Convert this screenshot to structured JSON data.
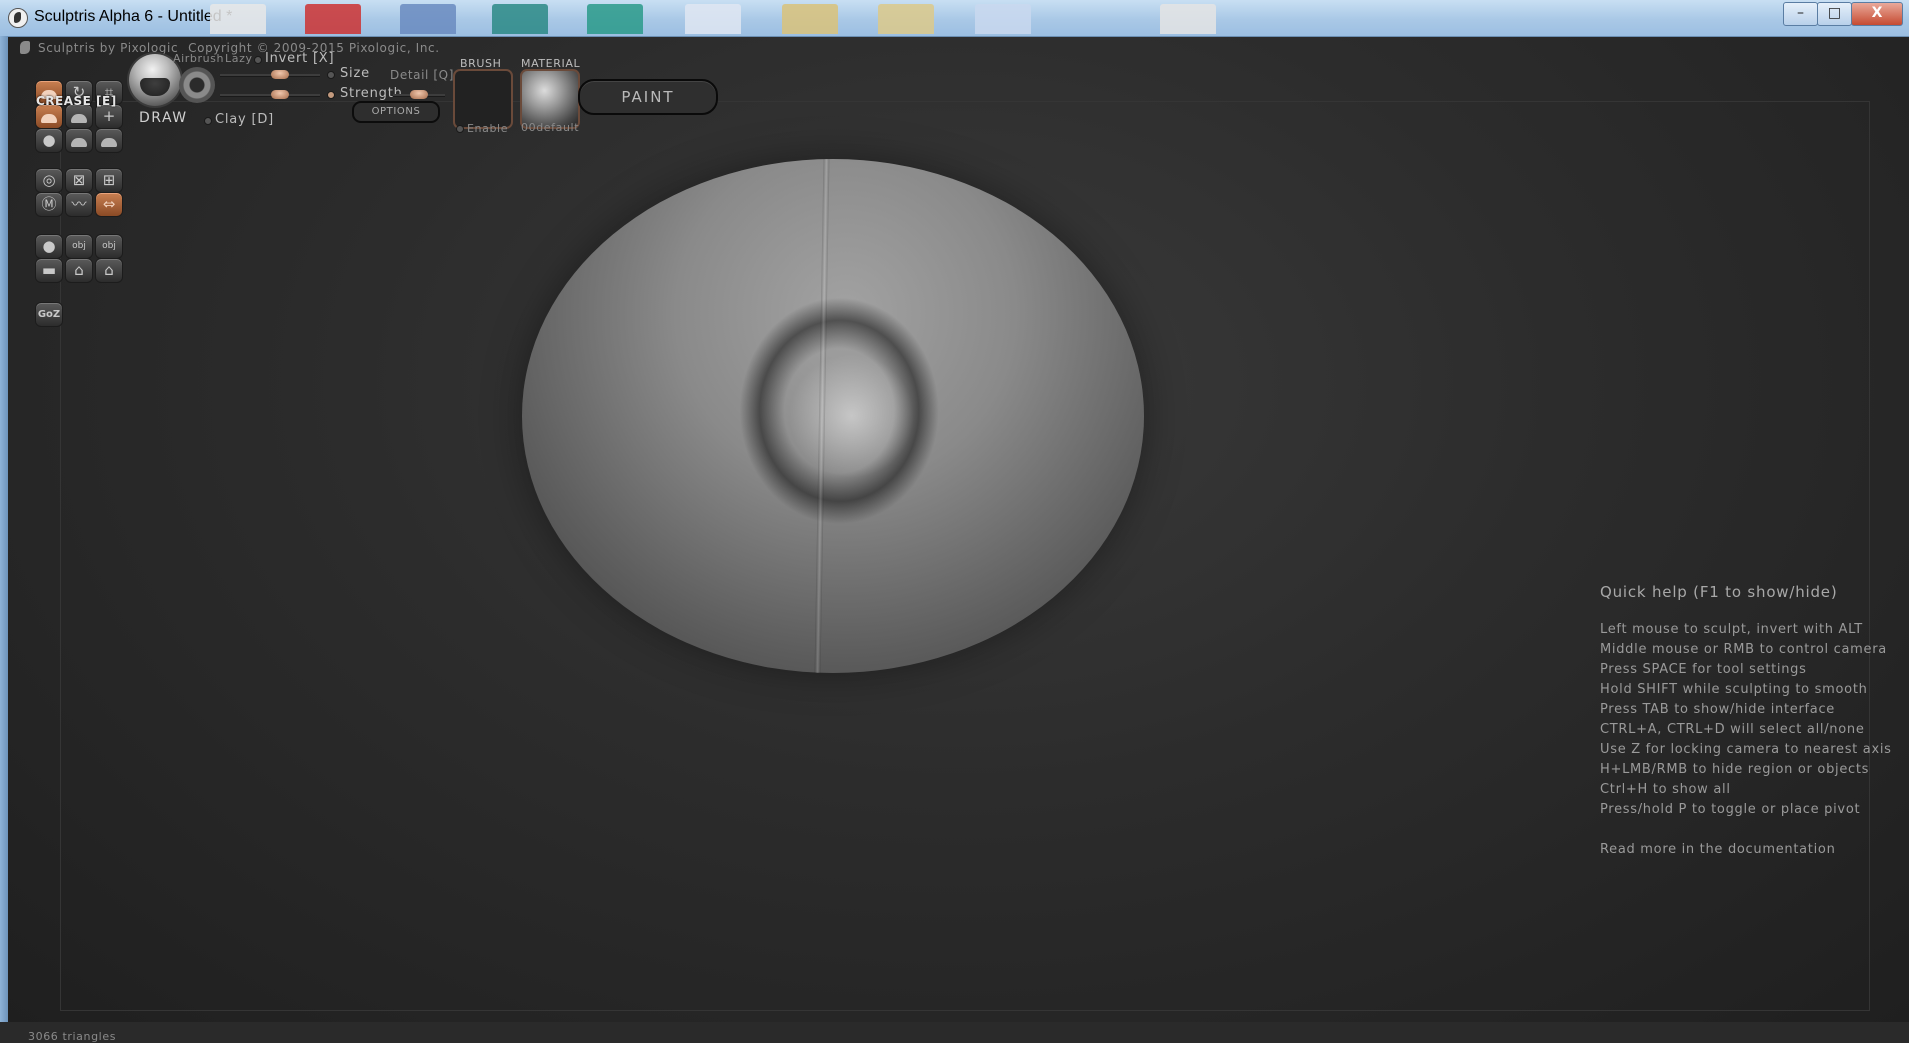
{
  "window": {
    "title": "Sculptris Alpha 6 - Untitled *",
    "minimize": "–",
    "maximize": "□",
    "close": "X"
  },
  "app": {
    "by": "Sculptris by Pixologic",
    "copyright": "Copyright © 2009-2015 Pixologic, Inc."
  },
  "tools": {
    "crease_label": "CREASE [E]",
    "goz_label": "GoZ"
  },
  "brush_panel": {
    "name": "DRAW",
    "airbrush": "Airbrush",
    "lazy": "Lazy",
    "invert": "Invert [X]",
    "size": "Size",
    "strength": "Strength",
    "detail": "Detail [Q]",
    "clay": "Clay [D]",
    "options": "OPTIONS",
    "brush_label": "BRUSH",
    "enable": "Enable",
    "material_label": "MATERIAL",
    "material_name": "00default",
    "paint": "PAINT",
    "size_level": 0.6,
    "strength_level": 0.6,
    "detail_level": 0.5
  },
  "help": {
    "title": "Quick help (F1 to show/hide)",
    "lines": [
      "Left mouse to sculpt, invert with ALT",
      "Middle mouse or RMB to control camera",
      "Press SPACE for tool settings",
      "Hold SHIFT while sculpting to smooth",
      "Press TAB to show/hide interface",
      "CTRL+A, CTRL+D will select all/none",
      "Use Z for locking camera to nearest axis",
      "H+LMB/RMB to hide region or objects",
      "Ctrl+H to show all",
      "Press/hold P to toggle or place pivot"
    ],
    "more": "Read more in the documentation"
  },
  "status": {
    "triangles": "3066 triangles"
  },
  "colors": {
    "accent": "#c98052",
    "background": "#2a2a2a",
    "titlebar": "#a9c8e6"
  }
}
